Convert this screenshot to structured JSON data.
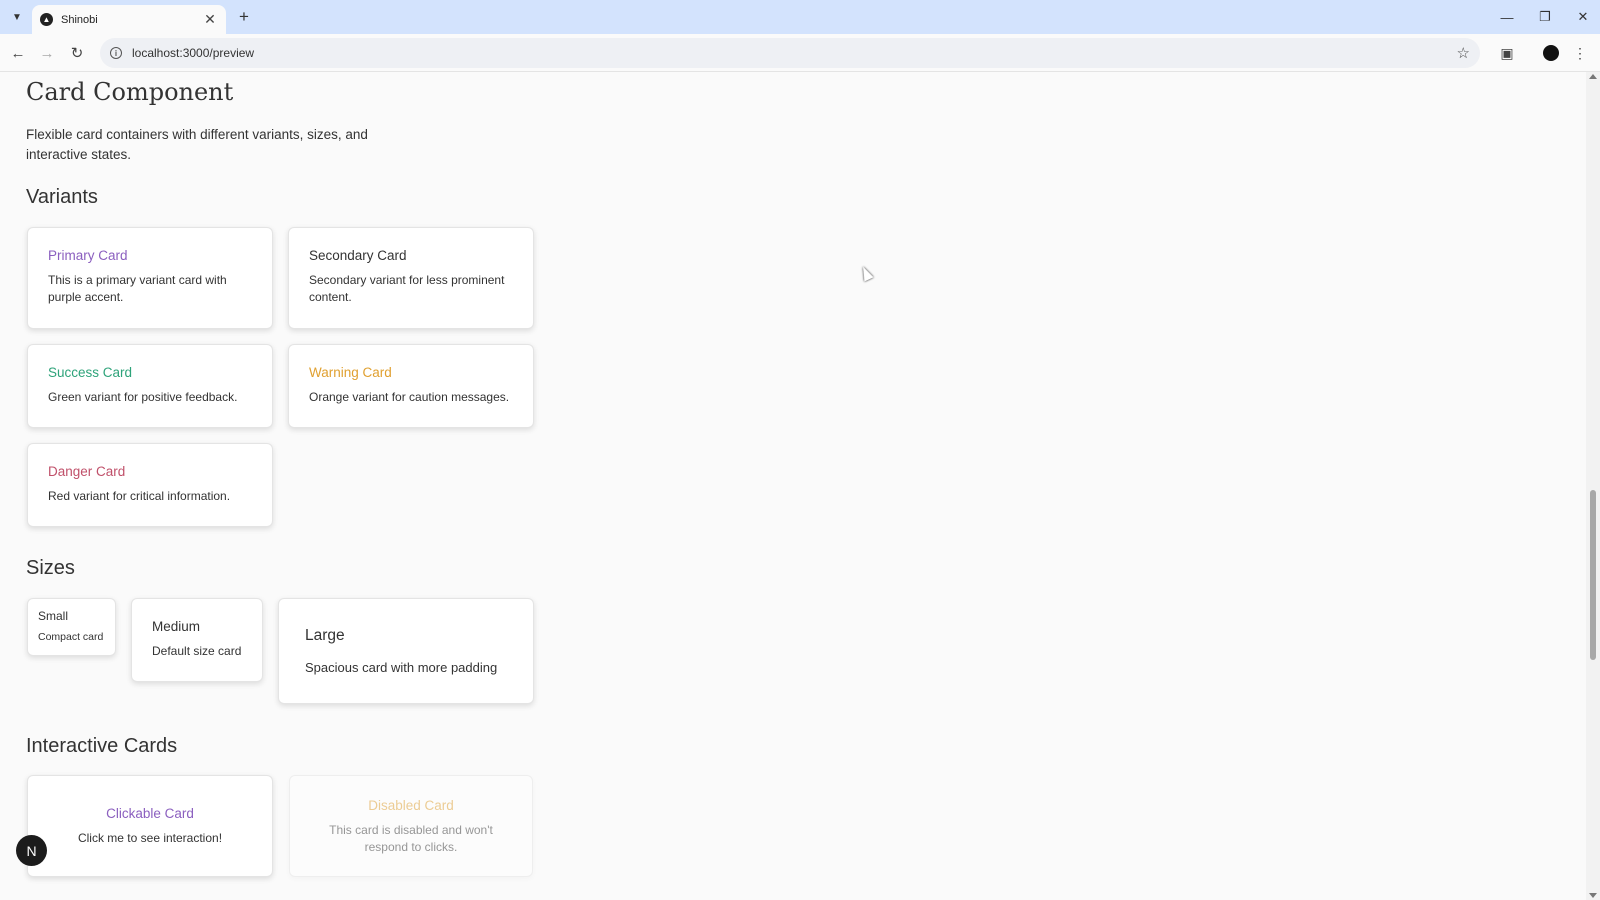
{
  "browser": {
    "tab_title": "Shinobi",
    "url": "localhost:3000/preview"
  },
  "page": {
    "title": "Card Component",
    "description": "Flexible card containers with different variants, sizes, and interactive states."
  },
  "sections": {
    "variants": "Variants",
    "sizes": "Sizes",
    "interactive": "Interactive Cards"
  },
  "variants": {
    "primary": {
      "title": "Primary Card",
      "body": "This is a primary variant card with purple accent.",
      "color": "#8b5fbf"
    },
    "secondary": {
      "title": "Secondary Card",
      "body": "Secondary variant for less prominent content.",
      "color": "#333333"
    },
    "success": {
      "title": "Success Card",
      "body": "Green variant for positive feedback.",
      "color": "#2ea37a"
    },
    "warning": {
      "title": "Warning Card",
      "body": "Orange variant for caution messages.",
      "color": "#e0a030"
    },
    "danger": {
      "title": "Danger Card",
      "body": "Red variant for critical information.",
      "color": "#c0506a"
    }
  },
  "sizes": {
    "small": {
      "title": "Small",
      "body": "Compact card"
    },
    "medium": {
      "title": "Medium",
      "body": "Default size card"
    },
    "large": {
      "title": "Large",
      "body": "Spacious card with more padding"
    }
  },
  "interactive": {
    "clickable": {
      "title": "Clickable Card",
      "body": "Click me to see interaction!",
      "color": "#8b5fbf"
    },
    "disabled": {
      "title": "Disabled Card",
      "body": "This card is disabled and won't respond to clicks.",
      "color": "#e0a030"
    }
  },
  "badge": {
    "letter": "N"
  },
  "colors": {
    "tabbar": "#d3e3fd",
    "background": "#fafafa"
  }
}
